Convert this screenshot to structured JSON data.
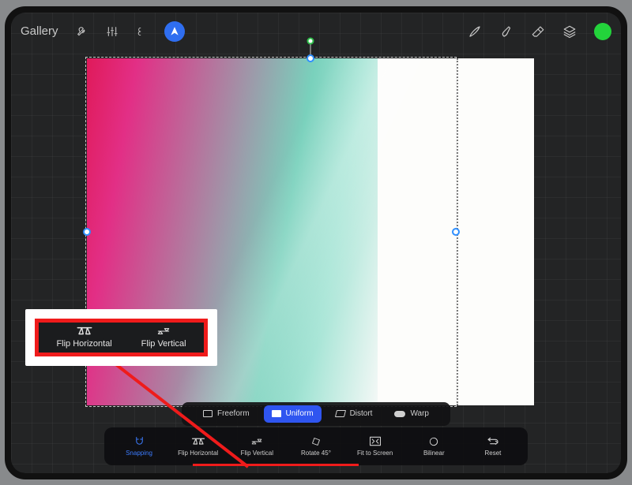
{
  "topbar": {
    "gallery_label": "Gallery"
  },
  "canvas": {
    "rotation_handle_visible": true
  },
  "transform_modes": {
    "freeform": "Freeform",
    "uniform": "Uniform",
    "distort": "Distort",
    "warp": "Warp",
    "active": "uniform"
  },
  "transform_actions": {
    "snapping": "Snapping",
    "flip_horizontal": "Flip Horizontal",
    "flip_vertical": "Flip Vertical",
    "rotate_45": "Rotate 45°",
    "fit_to_screen": "Fit to Screen",
    "bilinear": "Bilinear",
    "reset": "Reset"
  },
  "callout": {
    "flip_horizontal": "Flip Horizontal",
    "flip_vertical": "Flip Vertical"
  },
  "colors": {
    "accent_blue": "#2f55f0",
    "annotation_red": "#ef1b1b",
    "active_color": "#23d33b"
  }
}
